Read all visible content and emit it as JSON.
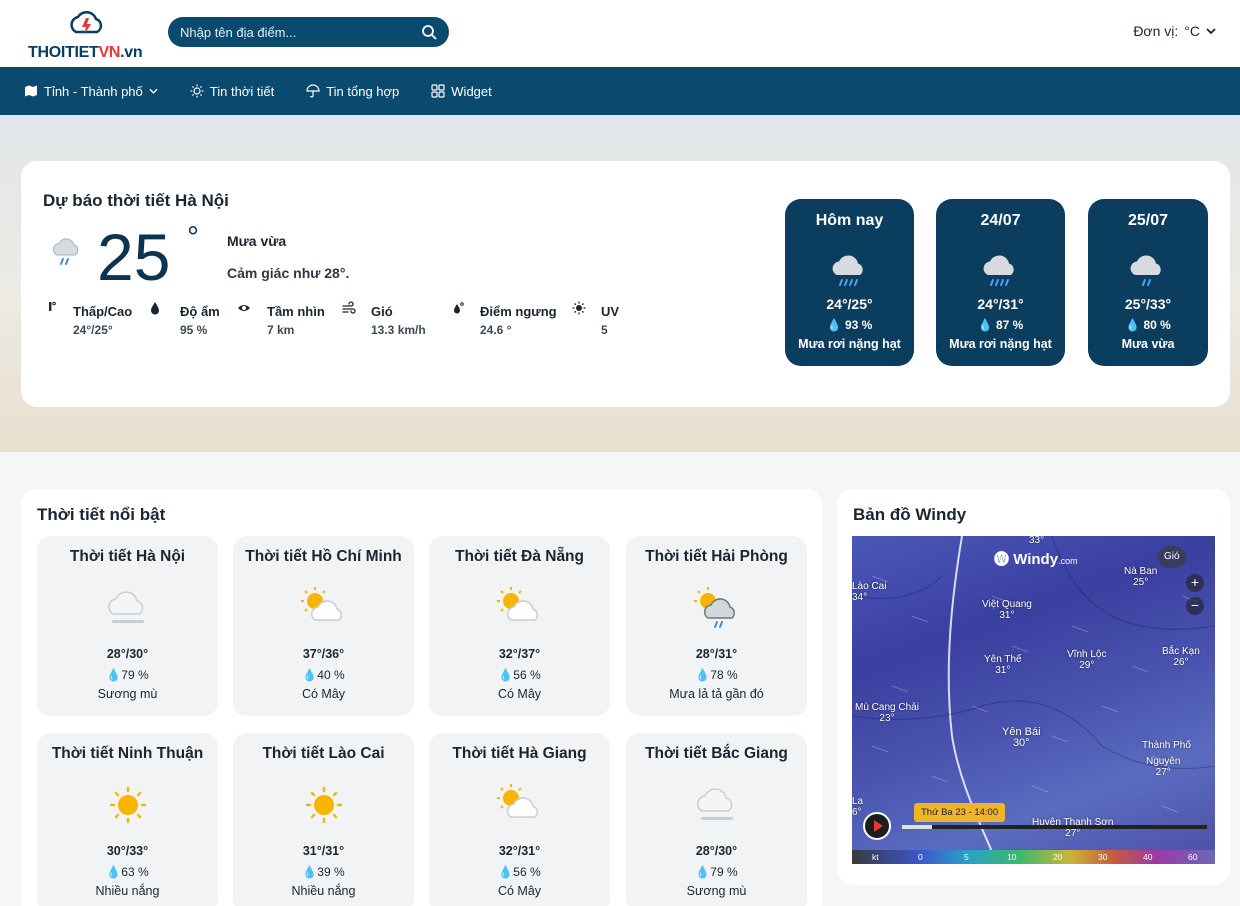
{
  "header": {
    "logo_main": "THOITIET",
    "logo_accent": "VN",
    "logo_domain": ".vn",
    "search_placeholder": "Nhập tên địa điểm...",
    "unit_label": "Đơn vị:",
    "unit_value": "°C"
  },
  "nav": {
    "items": [
      {
        "label": "Tỉnh - Thành phố",
        "icon": "map-icon",
        "has_dropdown": true
      },
      {
        "label": "Tin thời tiết",
        "icon": "sun-icon"
      },
      {
        "label": "Tin tổng hợp",
        "icon": "umbrella-icon"
      },
      {
        "label": "Widget",
        "icon": "grid-icon"
      }
    ]
  },
  "current": {
    "title": "Dự báo thời tiết Hà Nội",
    "temp": "25",
    "deg": "°",
    "desc": "Mưa vừa",
    "feels_like": "Cảm giác như 28°.",
    "stats": [
      {
        "label": "Thấp/Cao",
        "value": "24°/25°",
        "icon": "thermometer-icon"
      },
      {
        "label": "Độ ẩm",
        "value": "95 %",
        "icon": "droplet-icon"
      },
      {
        "label": "Tầm nhìn",
        "value": "7 km",
        "icon": "eye-icon"
      },
      {
        "label": "Gió",
        "value": "13.3 km/h",
        "icon": "wind-icon"
      },
      {
        "label": "Điểm ngưng",
        "value": "24.6 °",
        "icon": "dewpoint-icon"
      },
      {
        "label": "UV",
        "value": "5",
        "icon": "uv-icon"
      }
    ]
  },
  "forecast": [
    {
      "day": "Hôm nay",
      "temp": "24°/25°",
      "humidity": "93 %",
      "desc": "Mưa rơi nặng hạt",
      "icon": "heavy-rain-icon"
    },
    {
      "day": "24/07",
      "temp": "24°/31°",
      "humidity": "87 %",
      "desc": "Mưa rơi nặng hạt",
      "icon": "heavy-rain-icon"
    },
    {
      "day": "25/07",
      "temp": "25°/33°",
      "humidity": "80 %",
      "desc": "Mưa vừa",
      "icon": "rain-icon"
    }
  ],
  "featured": {
    "title": "Thời tiết nổi bật",
    "cities": [
      {
        "name": "Thời tiết Hà Nội",
        "temp": "28°/30°",
        "humidity": "79 %",
        "desc": "Sương mù",
        "icon": "fog-icon"
      },
      {
        "name": "Thời tiết Hồ Chí Minh",
        "temp": "37°/36°",
        "humidity": "40 %",
        "desc": "Có Mây",
        "icon": "partly-cloudy-icon"
      },
      {
        "name": "Thời tiết Đà Nẵng",
        "temp": "32°/37°",
        "humidity": "56 %",
        "desc": "Có Mây",
        "icon": "partly-cloudy-icon"
      },
      {
        "name": "Thời tiết Hải Phòng",
        "temp": "28°/31°",
        "humidity": "78 %",
        "desc": "Mưa lả tả gần đó",
        "icon": "sun-rain-icon"
      },
      {
        "name": "Thời tiết Ninh Thuận",
        "temp": "30°/33°",
        "humidity": "63 %",
        "desc": "Nhiều nắng",
        "icon": "sunny-icon"
      },
      {
        "name": "Thời tiết Lào Cai",
        "temp": "31°/31°",
        "humidity": "39 %",
        "desc": "Nhiều nắng",
        "icon": "sunny-icon"
      },
      {
        "name": "Thời tiết Hà Giang",
        "temp": "32°/31°",
        "humidity": "56 %",
        "desc": "Có Mây",
        "icon": "partly-cloudy-icon"
      },
      {
        "name": "Thời tiết Bắc Giang",
        "temp": "28°/30°",
        "humidity": "79 %",
        "desc": "Sương mù",
        "icon": "fog-icon"
      }
    ]
  },
  "windy": {
    "title": "Bản đồ Windy",
    "logo": "Windy",
    "logo_suffix": ".com",
    "wind_pill": "Gió",
    "time": "Thứ Ba 23 - 14:00",
    "labels": [
      {
        "name": "33°",
        "sub": ""
      },
      {
        "name": "Lào Cai",
        "sub": "34°"
      },
      {
        "name": "Nà Ban",
        "sub": "25°"
      },
      {
        "name": "Việt Quang",
        "sub": "31°"
      },
      {
        "name": "Yên Thế",
        "sub": "31°"
      },
      {
        "name": "Vĩnh Lộc",
        "sub": "29°"
      },
      {
        "name": "Bắc Kạn",
        "sub": "26°"
      },
      {
        "name": "Mù Cang Chải",
        "sub": "23°"
      },
      {
        "name": "Yên Bái",
        "sub": "30°"
      },
      {
        "name": "Thành Phố",
        "sub": ""
      },
      {
        "name": "Nguyên",
        "sub": "27°"
      },
      {
        "name": "Huyện Thanh Sơn",
        "sub": "27°"
      },
      {
        "name": "La",
        "sub": "6°"
      }
    ],
    "scale": [
      "kt",
      "0",
      "5",
      "10",
      "20",
      "30",
      "40",
      "60"
    ]
  }
}
